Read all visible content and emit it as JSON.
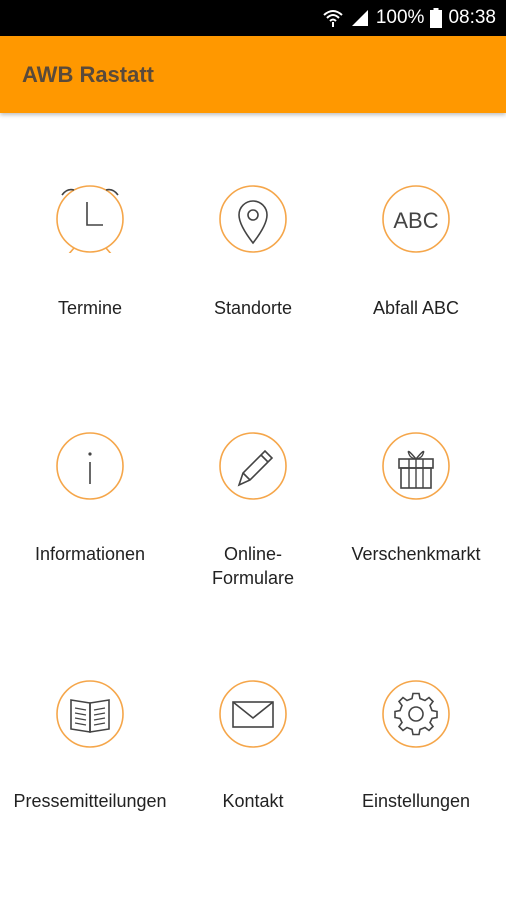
{
  "status": {
    "battery": "100%",
    "time": "08:38"
  },
  "app": {
    "title": "AWB Rastatt",
    "accent": "#FF9800",
    "icon_stroke": "#F5A64A"
  },
  "menu": [
    {
      "label": "Termine",
      "icon": "alarm-clock-icon"
    },
    {
      "label": "Standorte",
      "icon": "map-pin-icon"
    },
    {
      "label": "Abfall ABC",
      "icon": "abc-icon",
      "icon_text": "ABC"
    },
    {
      "label": "Informationen",
      "icon": "info-icon"
    },
    {
      "label_line1": "Online-",
      "label_line2": "Formulare",
      "icon": "pencil-icon"
    },
    {
      "label": "Verschenkmarkt",
      "icon": "gift-icon"
    },
    {
      "label": "Pressemitteilungen",
      "icon": "book-icon"
    },
    {
      "label": "Kontakt",
      "icon": "envelope-icon"
    },
    {
      "label": "Einstellungen",
      "icon": "gear-icon"
    }
  ]
}
